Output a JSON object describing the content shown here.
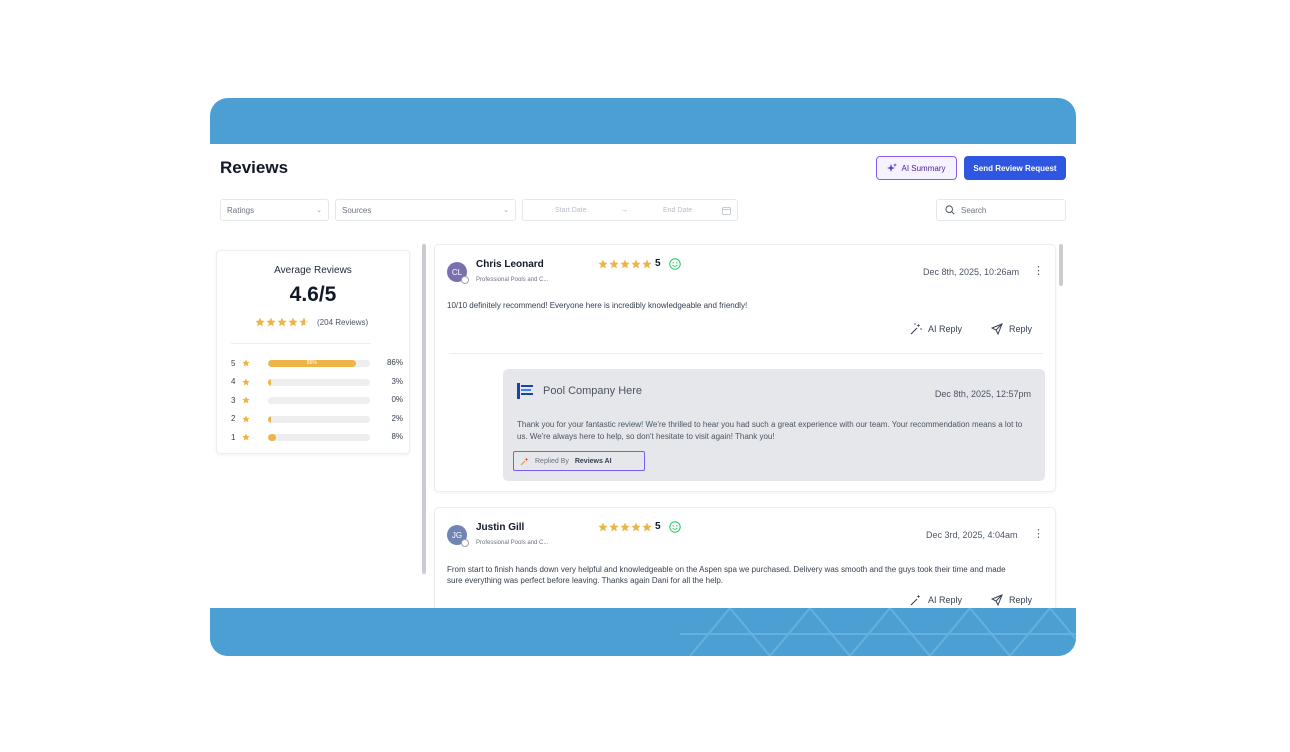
{
  "header": {
    "title": "Reviews",
    "ai_summary_label": "AI Summary",
    "send_request_label": "Send Review Request"
  },
  "filters": {
    "ratings_placeholder": "Ratings",
    "sources_placeholder": "Sources",
    "start_date_placeholder": "Start Date",
    "end_date_placeholder": "End Date",
    "search_placeholder": "Search"
  },
  "summary": {
    "title": "Average Reviews",
    "average": "4.6/5",
    "average_value": 4.6,
    "count_label": "(204 Reviews)",
    "distribution": [
      {
        "stars": "5",
        "percent": 86,
        "label": "86%",
        "bar_text": "86%"
      },
      {
        "stars": "4",
        "percent": 3,
        "label": "3%"
      },
      {
        "stars": "3",
        "percent": 0,
        "label": "0%"
      },
      {
        "stars": "2",
        "percent": 2,
        "label": "2%"
      },
      {
        "stars": "1",
        "percent": 8,
        "label": "8%"
      }
    ],
    "star_color": "#edb446"
  },
  "reviews": [
    {
      "initials": "CL",
      "name": "Chris Leonard",
      "company": "Professional Pools and C...",
      "rating": "5",
      "rating_value": 5,
      "date": "Dec 8th, 2025, 10:26am",
      "text": "10/10 definitely recommend! Everyone here is incredibly knowledgeable and friendly!",
      "ai_reply_label": "AI Reply",
      "reply_label": "Reply",
      "avatar_color": "#7c6fb0",
      "response": {
        "company": "Pool Company Here",
        "date": "Dec 8th, 2025, 12:57pm",
        "text": "Thank you for your fantastic review! We're thrilled to hear you had such a great experience with our team. Your recommendation means a lot to us. We're always here to help, so don't hesitate to visit again! Thank you!",
        "replied_by_prefix": "Replied By",
        "replied_by_name": "Reviews AI"
      }
    },
    {
      "initials": "JG",
      "name": "Justin Gill",
      "company": "Professional Pools and C...",
      "rating": "5",
      "rating_value": 5,
      "date": "Dec 3rd, 2025, 4:04am",
      "text": "From start to finish hands down very helpful and knowledgeable on the Aspen spa we purchased. Delivery was smooth and the guys took their time and made sure everything was perfect before leaving. Thanks again Dani for all the help.",
      "ai_reply_label": "AI Reply",
      "reply_label": "Reply",
      "avatar_color": "#6f86b5"
    }
  ],
  "colors": {
    "frame": "#4b9fd3",
    "primary_button": "#2f56e0",
    "ai_accent": "#8b5cf6",
    "smiley": "#22c55e"
  },
  "icons": {
    "ai": "sparkles-icon",
    "search": "search-icon",
    "calendar": "calendar-icon",
    "reply": "send-icon",
    "ai_reply": "magic-wand-icon",
    "more": "kebab-icon",
    "sentiment": "smiley-icon"
  }
}
